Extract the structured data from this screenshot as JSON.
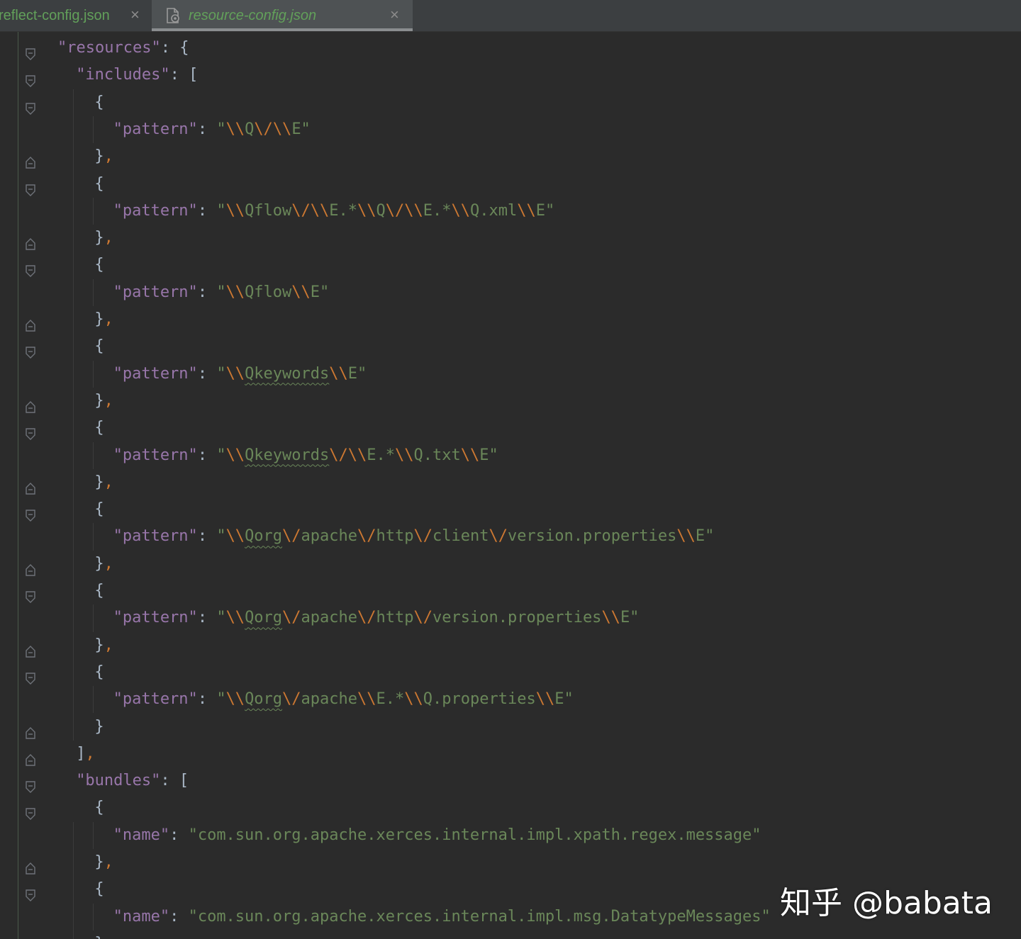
{
  "tabs": [
    {
      "label": "reflect-config.json",
      "active": false,
      "close_icon": "close-icon"
    },
    {
      "label": "resource-config.json",
      "active": true,
      "close_icon": "close-icon",
      "icon": "json-config-file-icon"
    }
  ],
  "colors": {
    "background": "#2b2b2b",
    "key": "#9876aa",
    "string": "#6a8759",
    "escape": "#cc7832",
    "punctuation": "#a9b7c6",
    "tab_text": "#62a05a"
  },
  "code_lines": [
    {
      "indent": 0,
      "parts": [
        [
          "key",
          "\"resources\""
        ],
        [
          "punc",
          ": {"
        ]
      ],
      "fold": "open"
    },
    {
      "indent": 1,
      "parts": [
        [
          "key",
          "\"includes\""
        ],
        [
          "punc",
          ": ["
        ]
      ],
      "fold": "open"
    },
    {
      "indent": 2,
      "parts": [
        [
          "punc",
          "{"
        ]
      ],
      "fold": "open"
    },
    {
      "indent": 3,
      "parts": [
        [
          "key",
          "\"pattern\""
        ],
        [
          "punc",
          ": "
        ],
        [
          "str",
          "\""
        ],
        [
          "esc",
          "\\\\"
        ],
        [
          "str",
          "Q"
        ],
        [
          "esc",
          "\\/"
        ],
        [
          "esc",
          "\\\\"
        ],
        [
          "str",
          "E\""
        ]
      ]
    },
    {
      "indent": 2,
      "parts": [
        [
          "punc",
          "}"
        ],
        [
          "comma",
          ","
        ]
      ],
      "fold": "close"
    },
    {
      "indent": 2,
      "parts": [
        [
          "punc",
          "{"
        ]
      ],
      "fold": "open"
    },
    {
      "indent": 3,
      "parts": [
        [
          "key",
          "\"pattern\""
        ],
        [
          "punc",
          ": "
        ],
        [
          "str",
          "\""
        ],
        [
          "esc",
          "\\\\"
        ],
        [
          "str",
          "Qflow"
        ],
        [
          "esc",
          "\\/"
        ],
        [
          "esc",
          "\\\\"
        ],
        [
          "str",
          "E.*"
        ],
        [
          "esc",
          "\\\\"
        ],
        [
          "str",
          "Q"
        ],
        [
          "esc",
          "\\/"
        ],
        [
          "esc",
          "\\\\"
        ],
        [
          "str",
          "E.*"
        ],
        [
          "esc",
          "\\\\"
        ],
        [
          "str",
          "Q.xml"
        ],
        [
          "esc",
          "\\\\"
        ],
        [
          "str",
          "E\""
        ]
      ]
    },
    {
      "indent": 2,
      "parts": [
        [
          "punc",
          "}"
        ],
        [
          "comma",
          ","
        ]
      ],
      "fold": "close"
    },
    {
      "indent": 2,
      "parts": [
        [
          "punc",
          "{"
        ]
      ],
      "fold": "open"
    },
    {
      "indent": 3,
      "parts": [
        [
          "key",
          "\"pattern\""
        ],
        [
          "punc",
          ": "
        ],
        [
          "str",
          "\""
        ],
        [
          "esc",
          "\\\\"
        ],
        [
          "str",
          "Qflow"
        ],
        [
          "esc",
          "\\\\"
        ],
        [
          "str",
          "E\""
        ]
      ]
    },
    {
      "indent": 2,
      "parts": [
        [
          "punc",
          "}"
        ],
        [
          "comma",
          ","
        ]
      ],
      "fold": "close"
    },
    {
      "indent": 2,
      "parts": [
        [
          "punc",
          "{"
        ]
      ],
      "fold": "open"
    },
    {
      "indent": 3,
      "parts": [
        [
          "key",
          "\"pattern\""
        ],
        [
          "punc",
          ": "
        ],
        [
          "str",
          "\""
        ],
        [
          "esc",
          "\\\\"
        ],
        [
          "sq",
          "Qkeywords"
        ],
        [
          "esc",
          "\\\\"
        ],
        [
          "str",
          "E\""
        ]
      ]
    },
    {
      "indent": 2,
      "parts": [
        [
          "punc",
          "}"
        ],
        [
          "comma",
          ","
        ]
      ],
      "fold": "close"
    },
    {
      "indent": 2,
      "parts": [
        [
          "punc",
          "{"
        ]
      ],
      "fold": "open"
    },
    {
      "indent": 3,
      "parts": [
        [
          "key",
          "\"pattern\""
        ],
        [
          "punc",
          ": "
        ],
        [
          "str",
          "\""
        ],
        [
          "esc",
          "\\\\"
        ],
        [
          "sq",
          "Qkeywords"
        ],
        [
          "esc",
          "\\/"
        ],
        [
          "esc",
          "\\\\"
        ],
        [
          "str",
          "E.*"
        ],
        [
          "esc",
          "\\\\"
        ],
        [
          "str",
          "Q.txt"
        ],
        [
          "esc",
          "\\\\"
        ],
        [
          "str",
          "E\""
        ]
      ]
    },
    {
      "indent": 2,
      "parts": [
        [
          "punc",
          "}"
        ],
        [
          "comma",
          ","
        ]
      ],
      "fold": "close"
    },
    {
      "indent": 2,
      "parts": [
        [
          "punc",
          "{"
        ]
      ],
      "fold": "open"
    },
    {
      "indent": 3,
      "parts": [
        [
          "key",
          "\"pattern\""
        ],
        [
          "punc",
          ": "
        ],
        [
          "str",
          "\""
        ],
        [
          "esc",
          "\\\\"
        ],
        [
          "sq",
          "Qorg"
        ],
        [
          "esc",
          "\\/"
        ],
        [
          "str",
          "apache"
        ],
        [
          "esc",
          "\\/"
        ],
        [
          "str",
          "http"
        ],
        [
          "esc",
          "\\/"
        ],
        [
          "str",
          "client"
        ],
        [
          "esc",
          "\\/"
        ],
        [
          "str",
          "version.properties"
        ],
        [
          "esc",
          "\\\\"
        ],
        [
          "str",
          "E\""
        ]
      ]
    },
    {
      "indent": 2,
      "parts": [
        [
          "punc",
          "}"
        ],
        [
          "comma",
          ","
        ]
      ],
      "fold": "close"
    },
    {
      "indent": 2,
      "parts": [
        [
          "punc",
          "{"
        ]
      ],
      "fold": "open"
    },
    {
      "indent": 3,
      "parts": [
        [
          "key",
          "\"pattern\""
        ],
        [
          "punc",
          ": "
        ],
        [
          "str",
          "\""
        ],
        [
          "esc",
          "\\\\"
        ],
        [
          "sq",
          "Qorg"
        ],
        [
          "esc",
          "\\/"
        ],
        [
          "str",
          "apache"
        ],
        [
          "esc",
          "\\/"
        ],
        [
          "str",
          "http"
        ],
        [
          "esc",
          "\\/"
        ],
        [
          "str",
          "version.properties"
        ],
        [
          "esc",
          "\\\\"
        ],
        [
          "str",
          "E\""
        ]
      ]
    },
    {
      "indent": 2,
      "parts": [
        [
          "punc",
          "}"
        ],
        [
          "comma",
          ","
        ]
      ],
      "fold": "close"
    },
    {
      "indent": 2,
      "parts": [
        [
          "punc",
          "{"
        ]
      ],
      "fold": "open"
    },
    {
      "indent": 3,
      "parts": [
        [
          "key",
          "\"pattern\""
        ],
        [
          "punc",
          ": "
        ],
        [
          "str",
          "\""
        ],
        [
          "esc",
          "\\\\"
        ],
        [
          "sq",
          "Qorg"
        ],
        [
          "esc",
          "\\/"
        ],
        [
          "str",
          "apache"
        ],
        [
          "esc",
          "\\\\"
        ],
        [
          "str",
          "E.*"
        ],
        [
          "esc",
          "\\\\"
        ],
        [
          "str",
          "Q.properties"
        ],
        [
          "esc",
          "\\\\"
        ],
        [
          "str",
          "E\""
        ]
      ]
    },
    {
      "indent": 2,
      "parts": [
        [
          "punc",
          "}"
        ]
      ],
      "fold": "close"
    },
    {
      "indent": 1,
      "parts": [
        [
          "punc",
          "]"
        ],
        [
          "comma",
          ","
        ]
      ],
      "fold": "close"
    },
    {
      "indent": 1,
      "parts": [
        [
          "key",
          "\"bundles\""
        ],
        [
          "punc",
          ": ["
        ]
      ],
      "fold": "open"
    },
    {
      "indent": 2,
      "parts": [
        [
          "punc",
          "{"
        ]
      ],
      "fold": "open"
    },
    {
      "indent": 3,
      "parts": [
        [
          "key",
          "\"name\""
        ],
        [
          "punc",
          ": "
        ],
        [
          "str",
          "\"com.sun.org.apache.xerces.internal.impl.xpath.regex.message\""
        ]
      ]
    },
    {
      "indent": 2,
      "parts": [
        [
          "punc",
          "}"
        ],
        [
          "comma",
          ","
        ]
      ],
      "fold": "close"
    },
    {
      "indent": 2,
      "parts": [
        [
          "punc",
          "{"
        ]
      ],
      "fold": "open"
    },
    {
      "indent": 3,
      "parts": [
        [
          "key",
          "\"name\""
        ],
        [
          "punc",
          ": "
        ],
        [
          "str",
          "\"com.sun.org.apache.xerces.internal.impl.msg.DatatypeMessages\""
        ]
      ]
    },
    {
      "indent": 2,
      "parts": [
        [
          "punc",
          "}"
        ],
        [
          "comma",
          ","
        ]
      ],
      "fold": "close"
    }
  ],
  "watermark": {
    "text": "知乎 @babata"
  }
}
